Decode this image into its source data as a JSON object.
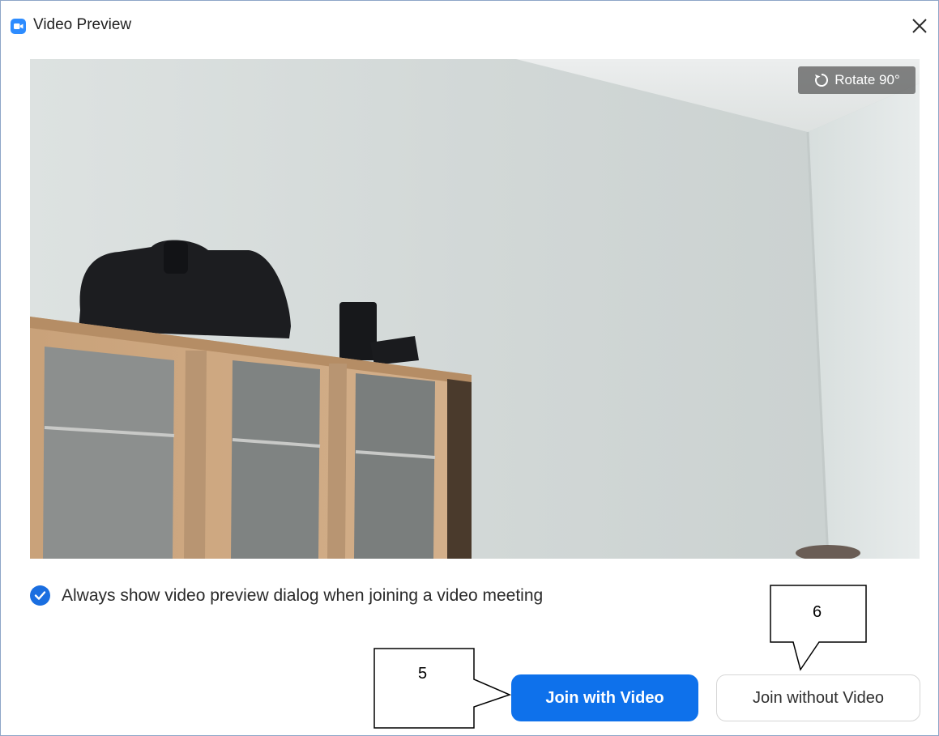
{
  "window": {
    "title": "Video Preview",
    "icon": "zoom-camera-icon",
    "close_icon": "close-icon"
  },
  "preview": {
    "rotate_label": "Rotate 90°",
    "rotate_icon": "rotate-icon"
  },
  "options": {
    "always_show_label": "Always show video preview dialog when joining a video meeting",
    "always_show_checked": true
  },
  "actions": {
    "join_with_video": "Join with Video",
    "join_without_video": "Join without Video"
  },
  "callouts": {
    "five": "5",
    "six": "6"
  },
  "colors": {
    "primary": "#0e71eb",
    "checkbox": "#1a6ee0"
  }
}
